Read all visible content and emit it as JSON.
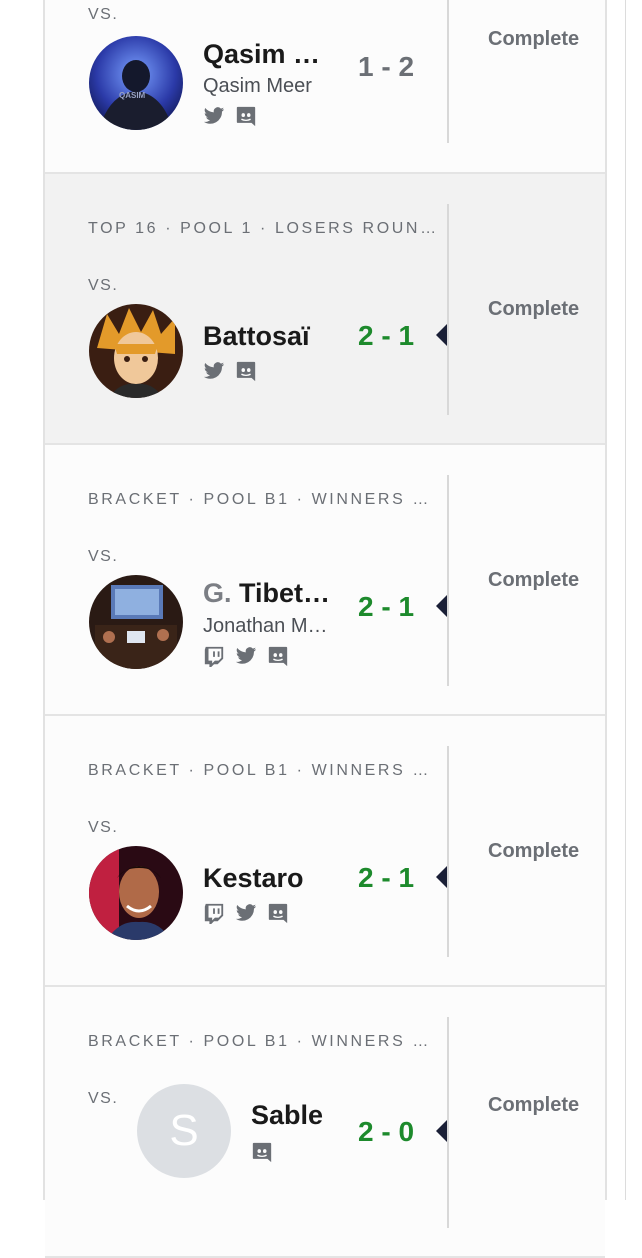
{
  "matches": [
    {
      "round": "",
      "vs": "VS.",
      "player": "Qasim Meer",
      "player_display": "Qasim …",
      "prefix": "",
      "realname": "Qasim Meer",
      "score": "1 - 2",
      "result": "loss",
      "status": "Complete",
      "socials": [
        "twitter-icon",
        "discord-icon"
      ]
    },
    {
      "round": "TOP 16 · POOL 1 · LOSERS ROUN…",
      "vs": "VS.",
      "player_display": "Battosaï",
      "prefix": "",
      "realname": "",
      "score": "2 - 1",
      "result": "win",
      "status": "Complete",
      "socials": [
        "twitter-icon",
        "discord-icon"
      ]
    },
    {
      "round": "BRACKET · POOL B1 · WINNERS …",
      "vs": "VS.",
      "player_display": "Tibet…",
      "prefix": "G.",
      "realname": "Jonathan M…",
      "score": "2 - 1",
      "result": "win",
      "status": "Complete",
      "socials": [
        "twitch-icon",
        "twitter-icon",
        "discord-icon"
      ]
    },
    {
      "round": "BRACKET · POOL B1 · WINNERS …",
      "vs": "VS.",
      "player_display": "Kestaro",
      "prefix": "",
      "realname": "",
      "score": "2 - 1",
      "result": "win",
      "status": "Complete",
      "socials": [
        "twitch-icon",
        "twitter-icon",
        "discord-icon"
      ]
    },
    {
      "round": "BRACKET · POOL B1 · WINNERS …",
      "vs": "VS.",
      "player_display": "Sable",
      "prefix": "",
      "realname": "",
      "avatar_initial": "S",
      "score": "2 - 0",
      "result": "win",
      "status": "Complete",
      "socials": [
        "discord-icon"
      ]
    }
  ],
  "colors": {
    "win": "#1d8a2c",
    "loss": "#6b6f75",
    "arrow": "#1a1f36",
    "highlight_bg": "#f2f2f2"
  }
}
